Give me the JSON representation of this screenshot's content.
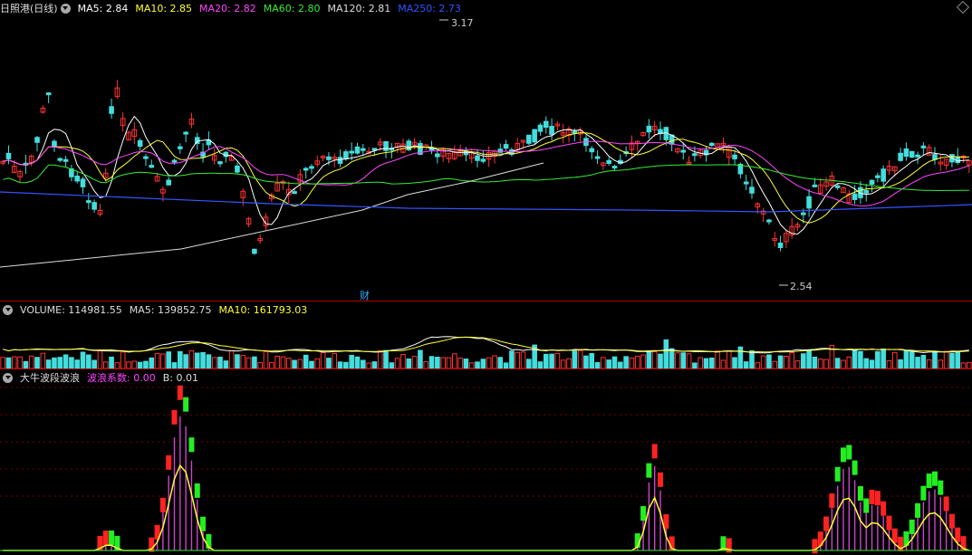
{
  "price_pane": {
    "stock": "日照港",
    "period": "(日线)",
    "ma": [
      {
        "label": "MA5:",
        "value": "2.84",
        "color": "#ffffff"
      },
      {
        "label": "MA10:",
        "value": "2.85",
        "color": "#ffff33"
      },
      {
        "label": "MA20:",
        "value": "2.82",
        "color": "#ff44ff"
      },
      {
        "label": "MA60:",
        "value": "2.80",
        "color": "#33ee33"
      },
      {
        "label": "MA120:",
        "value": "2.81",
        "color": "#dddddd"
      },
      {
        "label": "MA250:",
        "value": "2.73",
        "color": "#3355ff"
      }
    ],
    "high_label": "3.17",
    "low_label": "2.54",
    "marker": "财"
  },
  "volume_pane": {
    "title": "VOLUME:",
    "value": "114981.55",
    "ma5_label": "MA5:",
    "ma5_value": "139852.75",
    "ma10_label": "MA10:",
    "ma10_value": "161793.03"
  },
  "indicator_pane": {
    "title": "大牛波段波浪",
    "coef_label": "波浪系数:",
    "coef_value": "0.00",
    "b_label": "B:",
    "b_value": "0.01"
  },
  "colors": {
    "up": "#ff3333",
    "down": "#44dddd",
    "ma5": "#ffffff",
    "ma10": "#ffff33",
    "ma20": "#ff44ff",
    "ma60": "#33ee33",
    "ma120": "#dddddd",
    "ma250": "#3355ff"
  }
}
